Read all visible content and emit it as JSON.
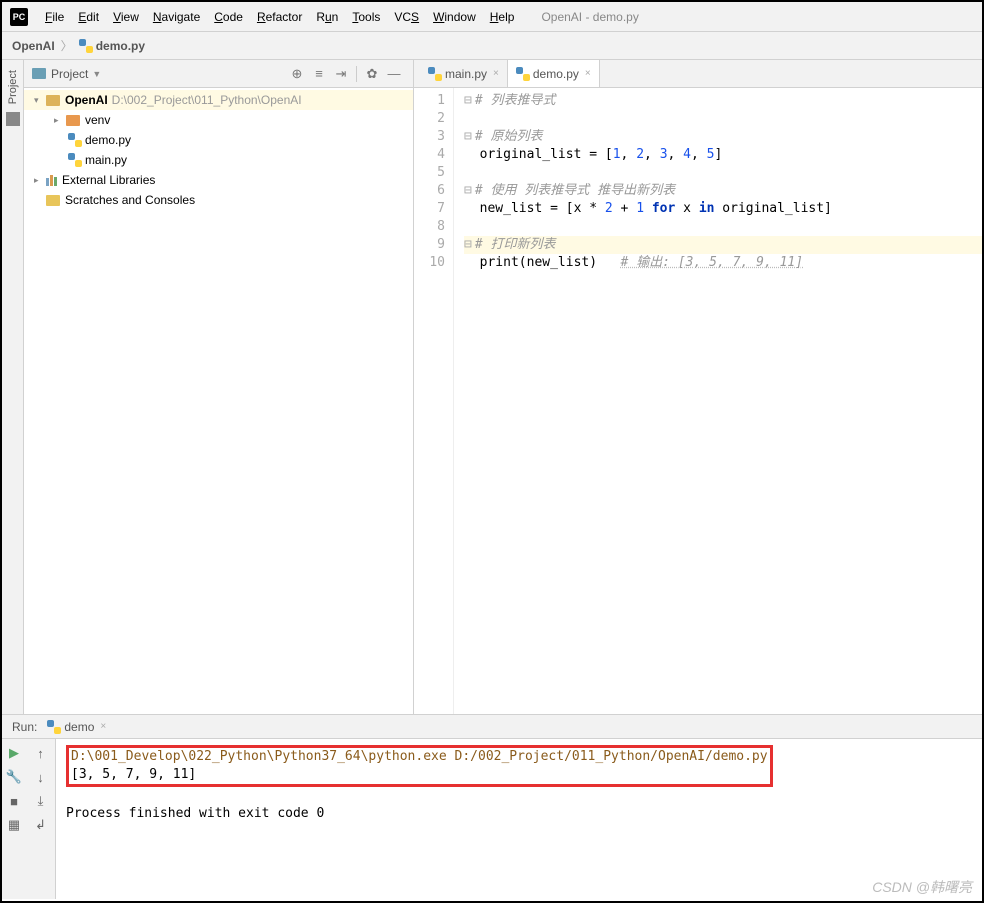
{
  "menu": {
    "items": [
      "File",
      "Edit",
      "View",
      "Navigate",
      "Code",
      "Refactor",
      "Run",
      "Tools",
      "VCS",
      "Window",
      "Help"
    ],
    "accel": [
      "F",
      "E",
      "V",
      "N",
      "C",
      "R",
      "u",
      "T",
      "S",
      "W",
      "H"
    ],
    "title": "OpenAI - demo.py",
    "appIcon": "PC"
  },
  "breadcrumb": {
    "a": "OpenAI",
    "b": "demo.py"
  },
  "projectPanel": {
    "title": "Project"
  },
  "tree": {
    "root": {
      "name": "OpenAI",
      "path": "D:\\002_Project\\011_Python\\OpenAI"
    },
    "venv": "venv",
    "demo": "demo.py",
    "main": "main.py",
    "ext": "External Libraries",
    "scr": "Scratches and Consoles"
  },
  "tabs": [
    {
      "label": "main.py",
      "active": false
    },
    {
      "label": "demo.py",
      "active": true
    }
  ],
  "code": {
    "lines": [
      {
        "n": "1",
        "t": "comment",
        "text": "# 列表推导式"
      },
      {
        "n": "2",
        "t": "blank",
        "text": ""
      },
      {
        "n": "3",
        "t": "comment",
        "text": "# 原始列表"
      },
      {
        "n": "4",
        "t": "code",
        "raw": "original_list = [1, 2, 3, 4, 5]"
      },
      {
        "n": "5",
        "t": "blank",
        "text": ""
      },
      {
        "n": "6",
        "t": "comment",
        "text": "# 使用 列表推导式 推导出新列表"
      },
      {
        "n": "7",
        "t": "code",
        "raw": "new_list = [x * 2 + 1 for x in original_list]"
      },
      {
        "n": "8",
        "t": "blank",
        "text": ""
      },
      {
        "n": "9",
        "t": "comment",
        "text": "# 打印新列表",
        "hl": true
      },
      {
        "n": "10",
        "t": "code2",
        "raw": "print(new_list)   ",
        "tail": "# 输出: [3, 5, 7, 9, 11]"
      }
    ]
  },
  "run": {
    "title": "Run:",
    "tab": "demo",
    "cmd": "D:\\001_Develop\\022_Python\\Python37_64\\python.exe D:/002_Project/011_Python/OpenAI/demo.py",
    "output": "[3, 5, 7, 9, 11]",
    "exit": "Process finished with exit code 0"
  },
  "watermark": "CSDN @韩曙亮"
}
